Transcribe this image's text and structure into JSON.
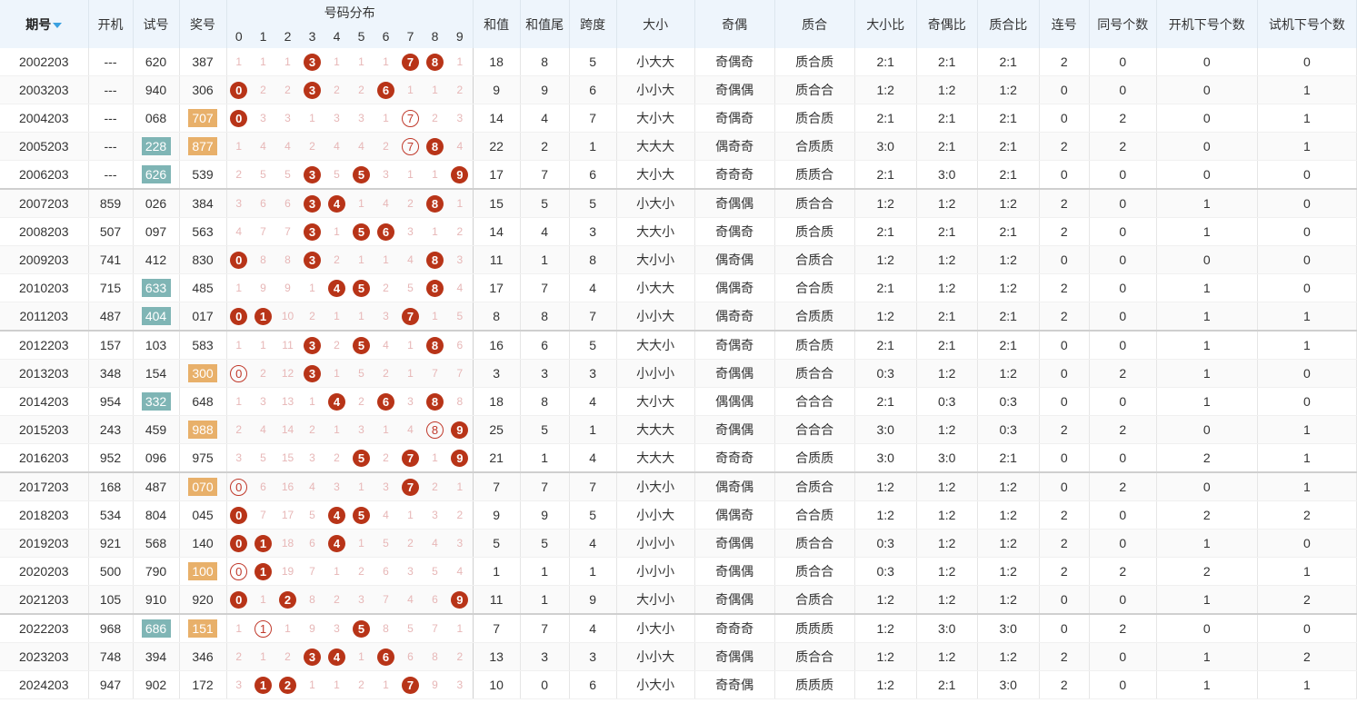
{
  "header": {
    "period": "期号",
    "open": "开机",
    "test": "试号",
    "award": "奖号",
    "dist": "号码分布",
    "digits": [
      "0",
      "1",
      "2",
      "3",
      "4",
      "5",
      "6",
      "7",
      "8",
      "9"
    ],
    "cols": [
      "和值",
      "和值尾",
      "跨度",
      "大小",
      "奇偶",
      "质合",
      "大小比",
      "奇偶比",
      "质合比",
      "连号",
      "同号个数",
      "开机下号个数",
      "试机下号个数"
    ]
  },
  "colors": {
    "ball": "#b83418",
    "hollow": "#c0392b",
    "test_hl": "#7fb5b5",
    "award_hl": "#e8b06a",
    "header_bg": "#eef5fc"
  },
  "rows": [
    {
      "p": "2002203",
      "o": "---",
      "t": "620",
      "a": "387",
      "th": false,
      "ah": false,
      "d": [
        "1",
        "1",
        "1",
        "3",
        "1",
        "1",
        "1",
        "7",
        "8",
        "1"
      ],
      "b": [
        3,
        7,
        8
      ],
      "h": [],
      "s": "18",
      "st": "8",
      "k": "5",
      "dx": "小大大",
      "jo": "奇偶奇",
      "zh": "质合质",
      "r1": "2:1",
      "r2": "2:1",
      "r3": "2:1",
      "lh": "2",
      "th2": "0",
      "ok": "0",
      "tk": "0"
    },
    {
      "p": "2003203",
      "o": "---",
      "t": "940",
      "a": "306",
      "th": false,
      "ah": false,
      "d": [
        "0",
        "2",
        "2",
        "3",
        "2",
        "2",
        "6",
        "1",
        "1",
        "2"
      ],
      "b": [
        0,
        3,
        6
      ],
      "h": [],
      "s": "9",
      "st": "9",
      "k": "6",
      "dx": "小小大",
      "jo": "奇偶偶",
      "zh": "质合合",
      "r1": "1:2",
      "r2": "1:2",
      "r3": "1:2",
      "lh": "0",
      "th2": "0",
      "ok": "0",
      "tk": "1"
    },
    {
      "p": "2004203",
      "o": "---",
      "t": "068",
      "a": "707",
      "th": false,
      "ah": true,
      "d": [
        "0",
        "3",
        "3",
        "1",
        "3",
        "3",
        "1",
        "7",
        "2",
        "3"
      ],
      "b": [
        0
      ],
      "h": [
        7
      ],
      "s": "14",
      "st": "4",
      "k": "7",
      "dx": "大小大",
      "jo": "奇偶奇",
      "zh": "质合质",
      "r1": "2:1",
      "r2": "2:1",
      "r3": "2:1",
      "lh": "0",
      "th2": "2",
      "ok": "0",
      "tk": "1"
    },
    {
      "p": "2005203",
      "o": "---",
      "t": "228",
      "a": "877",
      "th": true,
      "ah": true,
      "d": [
        "1",
        "4",
        "4",
        "2",
        "4",
        "4",
        "2",
        "7",
        "8",
        "4"
      ],
      "b": [
        8
      ],
      "h": [
        7
      ],
      "s": "22",
      "st": "2",
      "k": "1",
      "dx": "大大大",
      "jo": "偶奇奇",
      "zh": "合质质",
      "r1": "3:0",
      "r2": "2:1",
      "r3": "2:1",
      "lh": "2",
      "th2": "2",
      "ok": "0",
      "tk": "1"
    },
    {
      "p": "2006203",
      "o": "---",
      "t": "626",
      "a": "539",
      "th": true,
      "ah": false,
      "d": [
        "2",
        "5",
        "5",
        "3",
        "5",
        "5",
        "3",
        "1",
        "1",
        "9"
      ],
      "b": [
        3,
        5,
        9
      ],
      "h": [],
      "s": "17",
      "st": "7",
      "k": "6",
      "dx": "大小大",
      "jo": "奇奇奇",
      "zh": "质质合",
      "r1": "2:1",
      "r2": "3:0",
      "r3": "2:1",
      "lh": "0",
      "th2": "0",
      "ok": "0",
      "tk": "0"
    },
    {
      "p": "2007203",
      "o": "859",
      "t": "026",
      "a": "384",
      "th": false,
      "ah": false,
      "d": [
        "3",
        "6",
        "6",
        "3",
        "4",
        "1",
        "4",
        "2",
        "8",
        "1"
      ],
      "b": [
        3,
        4,
        8
      ],
      "h": [],
      "s": "15",
      "st": "5",
      "k": "5",
      "dx": "小大小",
      "jo": "奇偶偶",
      "zh": "质合合",
      "r1": "1:2",
      "r2": "1:2",
      "r3": "1:2",
      "lh": "2",
      "th2": "0",
      "ok": "1",
      "tk": "0"
    },
    {
      "p": "2008203",
      "o": "507",
      "t": "097",
      "a": "563",
      "th": false,
      "ah": false,
      "d": [
        "4",
        "7",
        "7",
        "3",
        "1",
        "5",
        "6",
        "3",
        "1",
        "2"
      ],
      "b": [
        3,
        5,
        6
      ],
      "h": [],
      "s": "14",
      "st": "4",
      "k": "3",
      "dx": "大大小",
      "jo": "奇偶奇",
      "zh": "质合质",
      "r1": "2:1",
      "r2": "2:1",
      "r3": "2:1",
      "lh": "2",
      "th2": "0",
      "ok": "1",
      "tk": "0"
    },
    {
      "p": "2009203",
      "o": "741",
      "t": "412",
      "a": "830",
      "th": false,
      "ah": false,
      "d": [
        "0",
        "8",
        "8",
        "3",
        "2",
        "1",
        "1",
        "4",
        "8",
        "3"
      ],
      "b": [
        0,
        3,
        8
      ],
      "h": [],
      "s": "11",
      "st": "1",
      "k": "8",
      "dx": "大小小",
      "jo": "偶奇偶",
      "zh": "合质合",
      "r1": "1:2",
      "r2": "1:2",
      "r3": "1:2",
      "lh": "0",
      "th2": "0",
      "ok": "0",
      "tk": "0"
    },
    {
      "p": "2010203",
      "o": "715",
      "t": "633",
      "a": "485",
      "th": true,
      "ah": false,
      "d": [
        "1",
        "9",
        "9",
        "1",
        "4",
        "5",
        "2",
        "5",
        "8",
        "4"
      ],
      "b": [
        4,
        5,
        8
      ],
      "h": [],
      "s": "17",
      "st": "7",
      "k": "4",
      "dx": "小大大",
      "jo": "偶偶奇",
      "zh": "合合质",
      "r1": "2:1",
      "r2": "1:2",
      "r3": "1:2",
      "lh": "2",
      "th2": "0",
      "ok": "1",
      "tk": "0"
    },
    {
      "p": "2011203",
      "o": "487",
      "t": "404",
      "a": "017",
      "th": true,
      "ah": false,
      "d": [
        "0",
        "1",
        "10",
        "2",
        "1",
        "1",
        "3",
        "7",
        "1",
        "5"
      ],
      "b": [
        0,
        1,
        7
      ],
      "h": [],
      "s": "8",
      "st": "8",
      "k": "7",
      "dx": "小小大",
      "jo": "偶奇奇",
      "zh": "合质质",
      "r1": "1:2",
      "r2": "2:1",
      "r3": "2:1",
      "lh": "2",
      "th2": "0",
      "ok": "1",
      "tk": "1"
    },
    {
      "p": "2012203",
      "o": "157",
      "t": "103",
      "a": "583",
      "th": false,
      "ah": false,
      "d": [
        "1",
        "1",
        "11",
        "3",
        "2",
        "5",
        "4",
        "1",
        "8",
        "6"
      ],
      "b": [
        3,
        5,
        8
      ],
      "h": [],
      "s": "16",
      "st": "6",
      "k": "5",
      "dx": "大大小",
      "jo": "奇偶奇",
      "zh": "质合质",
      "r1": "2:1",
      "r2": "2:1",
      "r3": "2:1",
      "lh": "0",
      "th2": "0",
      "ok": "1",
      "tk": "1"
    },
    {
      "p": "2013203",
      "o": "348",
      "t": "154",
      "a": "300",
      "th": false,
      "ah": true,
      "d": [
        "0",
        "2",
        "12",
        "3",
        "1",
        "5",
        "2",
        "1",
        "7",
        "7"
      ],
      "b": [
        3
      ],
      "h": [
        0
      ],
      "s": "3",
      "st": "3",
      "k": "3",
      "dx": "小小小",
      "jo": "奇偶偶",
      "zh": "质合合",
      "r1": "0:3",
      "r2": "1:2",
      "r3": "1:2",
      "lh": "0",
      "th2": "2",
      "ok": "1",
      "tk": "0"
    },
    {
      "p": "2014203",
      "o": "954",
      "t": "332",
      "a": "648",
      "th": true,
      "ah": false,
      "d": [
        "1",
        "3",
        "13",
        "1",
        "4",
        "2",
        "6",
        "3",
        "8",
        "8"
      ],
      "b": [
        4,
        6,
        8
      ],
      "h": [],
      "s": "18",
      "st": "8",
      "k": "4",
      "dx": "大小大",
      "jo": "偶偶偶",
      "zh": "合合合",
      "r1": "2:1",
      "r2": "0:3",
      "r3": "0:3",
      "lh": "0",
      "th2": "0",
      "ok": "1",
      "tk": "0"
    },
    {
      "p": "2015203",
      "o": "243",
      "t": "459",
      "a": "988",
      "th": false,
      "ah": true,
      "d": [
        "2",
        "4",
        "14",
        "2",
        "1",
        "3",
        "1",
        "4",
        "8",
        "9"
      ],
      "b": [
        9
      ],
      "h": [
        8
      ],
      "s": "25",
      "st": "5",
      "k": "1",
      "dx": "大大大",
      "jo": "奇偶偶",
      "zh": "合合合",
      "r1": "3:0",
      "r2": "1:2",
      "r3": "0:3",
      "lh": "2",
      "th2": "2",
      "ok": "0",
      "tk": "1"
    },
    {
      "p": "2016203",
      "o": "952",
      "t": "096",
      "a": "975",
      "th": false,
      "ah": false,
      "d": [
        "3",
        "5",
        "15",
        "3",
        "2",
        "5",
        "2",
        "7",
        "1",
        "9"
      ],
      "b": [
        5,
        7,
        9
      ],
      "h": [],
      "s": "21",
      "st": "1",
      "k": "4",
      "dx": "大大大",
      "jo": "奇奇奇",
      "zh": "合质质",
      "r1": "3:0",
      "r2": "3:0",
      "r3": "2:1",
      "lh": "0",
      "th2": "0",
      "ok": "2",
      "tk": "1"
    },
    {
      "p": "2017203",
      "o": "168",
      "t": "487",
      "a": "070",
      "th": false,
      "ah": true,
      "d": [
        "0",
        "6",
        "16",
        "4",
        "3",
        "1",
        "3",
        "7",
        "2",
        "1"
      ],
      "b": [
        7
      ],
      "h": [
        0
      ],
      "s": "7",
      "st": "7",
      "k": "7",
      "dx": "小大小",
      "jo": "偶奇偶",
      "zh": "合质合",
      "r1": "1:2",
      "r2": "1:2",
      "r3": "1:2",
      "lh": "0",
      "th2": "2",
      "ok": "0",
      "tk": "1"
    },
    {
      "p": "2018203",
      "o": "534",
      "t": "804",
      "a": "045",
      "th": false,
      "ah": false,
      "d": [
        "0",
        "7",
        "17",
        "5",
        "4",
        "5",
        "4",
        "1",
        "3",
        "2"
      ],
      "b": [
        0,
        4,
        5
      ],
      "h": [],
      "s": "9",
      "st": "9",
      "k": "5",
      "dx": "小小大",
      "jo": "偶偶奇",
      "zh": "合合质",
      "r1": "1:2",
      "r2": "1:2",
      "r3": "1:2",
      "lh": "2",
      "th2": "0",
      "ok": "2",
      "tk": "2"
    },
    {
      "p": "2019203",
      "o": "921",
      "t": "568",
      "a": "140",
      "th": false,
      "ah": false,
      "d": [
        "0",
        "1",
        "18",
        "6",
        "4",
        "1",
        "5",
        "2",
        "4",
        "3"
      ],
      "b": [
        0,
        1,
        4
      ],
      "h": [],
      "s": "5",
      "st": "5",
      "k": "4",
      "dx": "小小小",
      "jo": "奇偶偶",
      "zh": "质合合",
      "r1": "0:3",
      "r2": "1:2",
      "r3": "1:2",
      "lh": "2",
      "th2": "0",
      "ok": "1",
      "tk": "0"
    },
    {
      "p": "2020203",
      "o": "500",
      "t": "790",
      "a": "100",
      "th": false,
      "ah": true,
      "d": [
        "0",
        "1",
        "19",
        "7",
        "1",
        "2",
        "6",
        "3",
        "5",
        "4"
      ],
      "b": [
        1
      ],
      "h": [
        0
      ],
      "s": "1",
      "st": "1",
      "k": "1",
      "dx": "小小小",
      "jo": "奇偶偶",
      "zh": "质合合",
      "r1": "0:3",
      "r2": "1:2",
      "r3": "1:2",
      "lh": "2",
      "th2": "2",
      "ok": "2",
      "tk": "1"
    },
    {
      "p": "2021203",
      "o": "105",
      "t": "910",
      "a": "920",
      "th": false,
      "ah": false,
      "d": [
        "0",
        "1",
        "2",
        "8",
        "2",
        "3",
        "7",
        "4",
        "6",
        "9"
      ],
      "b": [
        0,
        2,
        9
      ],
      "h": [],
      "s": "11",
      "st": "1",
      "k": "9",
      "dx": "大小小",
      "jo": "奇偶偶",
      "zh": "合质合",
      "r1": "1:2",
      "r2": "1:2",
      "r3": "1:2",
      "lh": "0",
      "th2": "0",
      "ok": "1",
      "tk": "2"
    },
    {
      "p": "2022203",
      "o": "968",
      "t": "686",
      "a": "151",
      "th": true,
      "ah": true,
      "d": [
        "1",
        "1",
        "1",
        "9",
        "3",
        "5",
        "8",
        "5",
        "7",
        "1"
      ],
      "b": [
        5
      ],
      "h": [
        1
      ],
      "s": "7",
      "st": "7",
      "k": "4",
      "dx": "小大小",
      "jo": "奇奇奇",
      "zh": "质质质",
      "r1": "1:2",
      "r2": "3:0",
      "r3": "3:0",
      "lh": "0",
      "th2": "2",
      "ok": "0",
      "tk": "0"
    },
    {
      "p": "2023203",
      "o": "748",
      "t": "394",
      "a": "346",
      "th": false,
      "ah": false,
      "d": [
        "2",
        "1",
        "2",
        "3",
        "4",
        "1",
        "6",
        "6",
        "8",
        "2"
      ],
      "b": [
        3,
        4,
        6
      ],
      "h": [],
      "s": "13",
      "st": "3",
      "k": "3",
      "dx": "小小大",
      "jo": "奇偶偶",
      "zh": "质合合",
      "r1": "1:2",
      "r2": "1:2",
      "r3": "1:2",
      "lh": "2",
      "th2": "0",
      "ok": "1",
      "tk": "2"
    },
    {
      "p": "2024203",
      "o": "947",
      "t": "902",
      "a": "172",
      "th": false,
      "ah": false,
      "d": [
        "3",
        "1",
        "2",
        "1",
        "1",
        "2",
        "1",
        "7",
        "9",
        "3"
      ],
      "b": [
        1,
        2,
        7
      ],
      "h": [],
      "s": "10",
      "st": "0",
      "k": "6",
      "dx": "小大小",
      "jo": "奇奇偶",
      "zh": "质质质",
      "r1": "1:2",
      "r2": "2:1",
      "r3": "3:0",
      "lh": "2",
      "th2": "0",
      "ok": "1",
      "tk": "1"
    }
  ]
}
